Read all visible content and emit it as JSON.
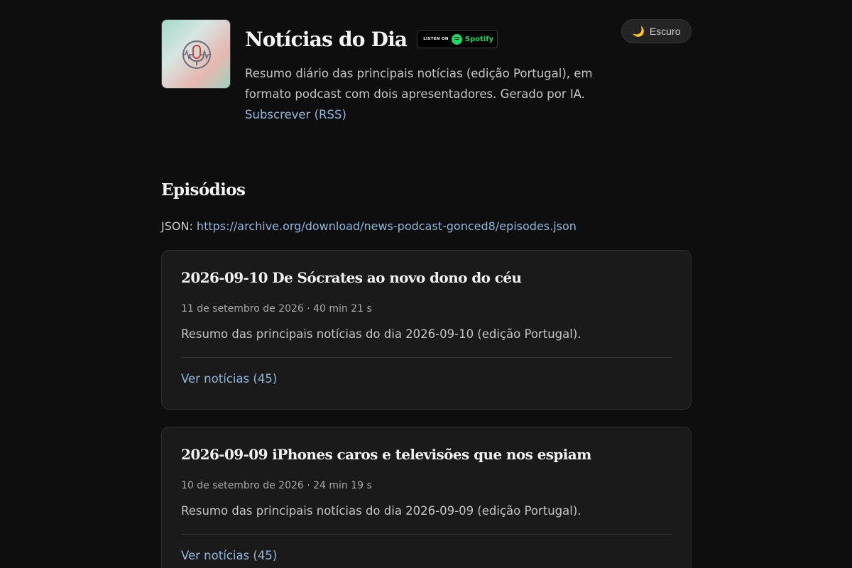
{
  "podcast": {
    "title": "Notícias do Dia",
    "spotify_badge": {
      "listen_text": "LISTEN ON",
      "brand": "Spotify"
    },
    "description": "Resumo diário das principais notícias (edição Portugal), em formato podcast com dois apresentadores. Gerado por IA.",
    "subscribe_label": "Subscrever (RSS)",
    "cover_icon": "microphone-icon"
  },
  "theme_toggle": {
    "icon": "moon-icon",
    "label": "Escuro"
  },
  "episodes_section": {
    "title": "Episódios",
    "json_label": "JSON:",
    "json_url": "https://archive.org/download/news-podcast-gonced8/episodes.json"
  },
  "episodes": [
    {
      "title": "2026-09-10 De Sócrates ao novo dono do céu",
      "meta": "11 de setembro de 2026 · 40 min 21 s",
      "summary": "Resumo das principais notícias do dia 2026-09-10 (edição Portugal).",
      "news_link": "Ver notícias (45)"
    },
    {
      "title": "2026-09-09 iPhones caros e televisões que nos espiam",
      "meta": "10 de setembro de 2026 · 24 min 19 s",
      "summary": "Resumo das principais notícias do dia 2026-09-09 (edição Portugal).",
      "news_link": "Ver notícias (45)"
    }
  ],
  "colors": {
    "background": "#0e0e0e",
    "card": "#1a1a1a",
    "link": "#8fb8dc",
    "spotify_green": "#1ed760"
  }
}
